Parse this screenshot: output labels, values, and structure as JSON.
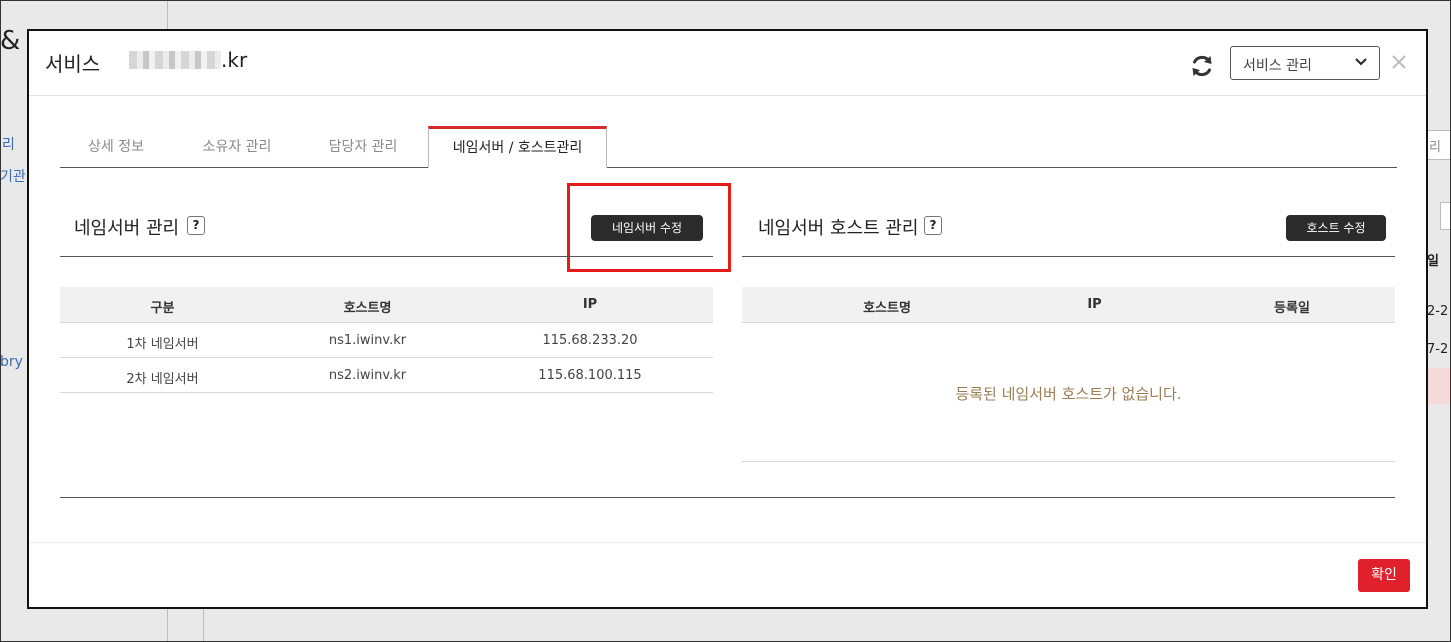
{
  "background": {
    "left_texts": [
      "리",
      "기관",
      "bry"
    ],
    "amp": "&",
    "right_texts": [
      "일",
      "2-2",
      "7-2"
    ],
    "right_box_text": "리"
  },
  "modal": {
    "title": "서비스",
    "domain_suffix": ".kr",
    "service_select": {
      "selected": "서비스 관리"
    },
    "icons": {
      "refresh": "refresh-icon",
      "close": "close-icon",
      "dropdown": "chevron-down-icon"
    }
  },
  "tabs": [
    {
      "label": "상세 정보",
      "active": false
    },
    {
      "label": "소유자 관리",
      "active": false
    },
    {
      "label": "담당자 관리",
      "active": false
    },
    {
      "label": "네임서버 / 호스트관리",
      "active": true
    }
  ],
  "nameserver": {
    "title": "네임서버 관리",
    "help": "?",
    "edit_button": "네임서버 수정",
    "columns": [
      "구분",
      "호스트명",
      "IP"
    ],
    "rows": [
      {
        "type": "1차 네임서버",
        "host": "ns1.iwinv.kr",
        "ip": "115.68.233.20"
      },
      {
        "type": "2차 네임서버",
        "host": "ns2.iwinv.kr",
        "ip": "115.68.100.115"
      }
    ]
  },
  "host": {
    "title": "네임서버 호스트 관리",
    "help": "?",
    "edit_button": "호스트 수정",
    "columns": [
      "호스트명",
      "IP",
      "등록일"
    ],
    "empty_message": "등록된 네임서버 호스트가 없습니다."
  },
  "footer": {
    "confirm_button": "확인"
  },
  "colors": {
    "accent_red": "#e0202b",
    "tab_active_border": "#d62828",
    "highlight_box": "#e31b1b",
    "empty_text": "#9c7d55"
  }
}
